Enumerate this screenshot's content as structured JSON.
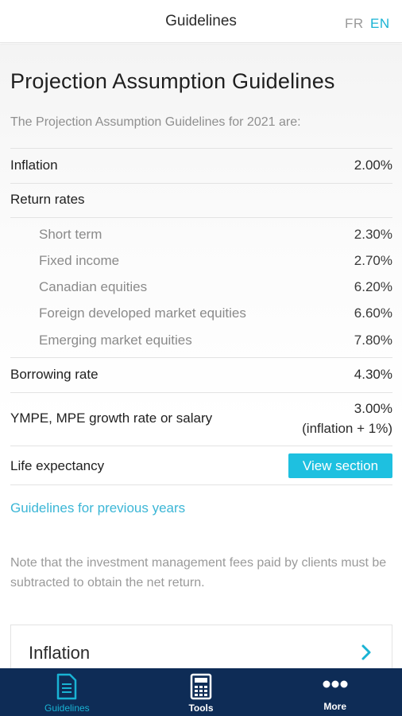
{
  "header": {
    "title": "Guidelines",
    "lang_fr": "FR",
    "lang_en": "EN"
  },
  "main": {
    "page_title": "Projection Assumption Guidelines",
    "intro": "The Projection Assumption Guidelines for 2021 are:",
    "inflation": {
      "label": "Inflation",
      "value": "2.00%"
    },
    "return_rates_label": "Return rates",
    "return_rates": [
      {
        "label": "Short term",
        "value": "2.30%"
      },
      {
        "label": "Fixed income",
        "value": "2.70%"
      },
      {
        "label": "Canadian equities",
        "value": "6.20%"
      },
      {
        "label": "Foreign developed market equities",
        "value": "6.60%"
      },
      {
        "label": "Emerging market equities",
        "value": "7.80%"
      }
    ],
    "borrowing": {
      "label": "Borrowing rate",
      "value": "4.30%"
    },
    "ympe": {
      "label": "YMPE, MPE growth rate or salary",
      "value_line1": "3.00%",
      "value_line2": "(inflation + 1%)"
    },
    "life": {
      "label": "Life expectancy",
      "button": "View section"
    },
    "prev_link": "Guidelines for previous years",
    "note": "Note that the investment management fees paid by clients must be subtracted to obtain the net return.",
    "card_title": "Inflation"
  },
  "bottom_nav": [
    {
      "label": "Guidelines",
      "icon": "document-icon",
      "active": true
    },
    {
      "label": "Tools",
      "icon": "calculator-icon",
      "active": false
    },
    {
      "label": "More",
      "icon": "more-dots-icon",
      "active": false
    }
  ],
  "colors": {
    "accent": "#19b3d4",
    "button": "#1ec0e0",
    "nav_bg": "#0e2c56"
  }
}
